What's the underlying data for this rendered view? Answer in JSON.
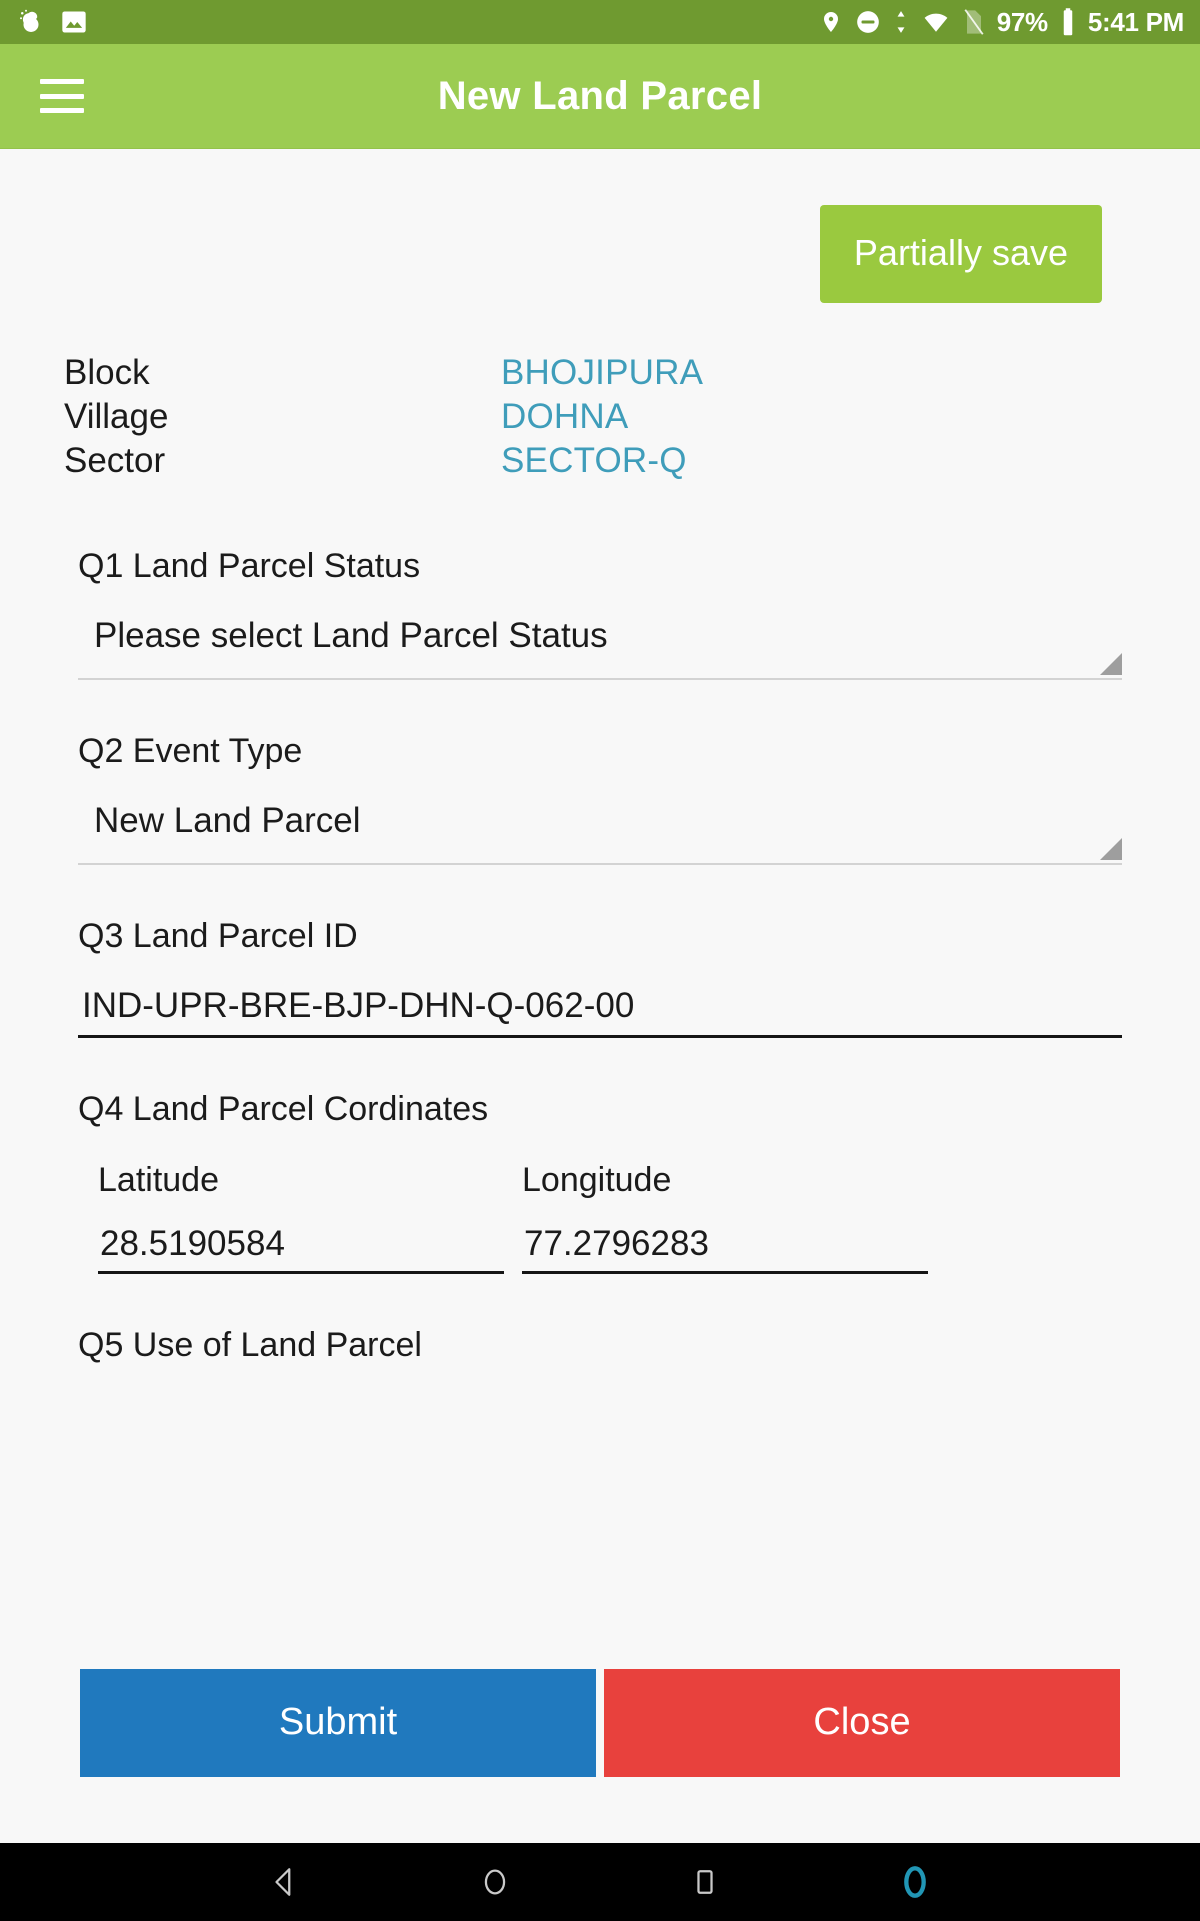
{
  "status_bar": {
    "left_icons": [
      "weather-cloud-icon",
      "gallery-image-icon"
    ],
    "right_icons": [
      "location-pin-icon",
      "do-not-disturb-icon",
      "sync-arrows-icon",
      "wifi-icon",
      "sim-card-off-icon",
      "battery-icon"
    ],
    "battery_percent": "97%",
    "time": "5:41 PM",
    "background_color": "#6f9a30"
  },
  "app_bar": {
    "menu_icon": "hamburger-menu-icon",
    "title": "New Land Parcel",
    "background_color": "#9ccc52"
  },
  "toolbar": {
    "partially_save_label": "Partially save",
    "partially_save_color": "#9ac93f"
  },
  "meta": {
    "rows": [
      {
        "label": "Block",
        "value": "BHOJIPURA"
      },
      {
        "label": "Village",
        "value": "DOHNA"
      },
      {
        "label": "Sector",
        "value": "SECTOR-Q"
      }
    ],
    "value_color": "#3f9dba"
  },
  "form": {
    "q1": {
      "label": "Q1 Land Parcel Status",
      "value": "Please select Land Parcel Status",
      "type": "spinner"
    },
    "q2": {
      "label": "Q2 Event Type",
      "value": "New Land Parcel",
      "type": "spinner"
    },
    "q3": {
      "label": "Q3 Land Parcel ID",
      "value": "IND-UPR-BRE-BJP-DHN-Q-062-00",
      "type": "text"
    },
    "q4": {
      "label": "Q4 Land Parcel Cordinates",
      "latitude_label": "Latitude",
      "latitude_value": "28.5190584",
      "longitude_label": "Longitude",
      "longitude_value": "77.2796283"
    },
    "q5": {
      "label": "Q5 Use of Land Parcel"
    }
  },
  "actions": {
    "submit_label": "Submit",
    "submit_color": "#2079be",
    "close_label": "Close",
    "close_color": "#e8413d"
  },
  "nav_bar": {
    "items": [
      "back-triangle-icon",
      "home-circle-icon",
      "recents-square-icon",
      "assistant-icon"
    ],
    "background_color": "#000000",
    "assistant_color": "#2196b5"
  }
}
